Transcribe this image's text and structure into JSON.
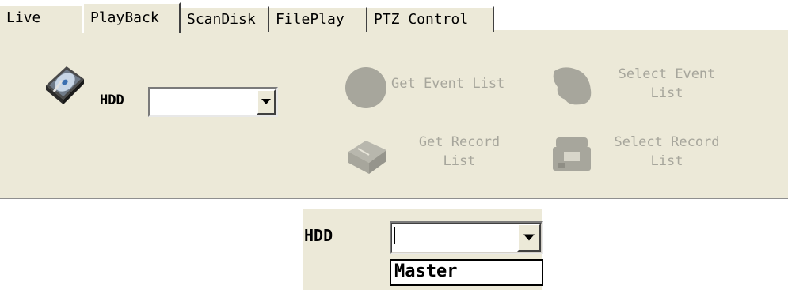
{
  "tabs": [
    {
      "label": "Live"
    },
    {
      "label": "PlayBack"
    },
    {
      "label": "ScanDisk"
    },
    {
      "label": "FilePlay"
    },
    {
      "label": "PTZ Control"
    }
  ],
  "selected_tab": "PlayBack",
  "playback": {
    "hdd_label": "HDD",
    "hdd_icon": "hard-disk-icon",
    "hdd_value": "",
    "actions": {
      "get_event_list": "Get Event List",
      "select_event_list_1": "Select Event",
      "select_event_list_2": "List",
      "get_record_list_1": "Get Record",
      "get_record_list_2": "List",
      "select_record_list_1": "Select Record",
      "select_record_list_2": "List"
    },
    "disabled_color": "#a7a69c",
    "panel_color": "#ece9d8"
  },
  "detail": {
    "hdd_label": "HDD",
    "dropdown_value": "",
    "options": [
      "Master"
    ]
  }
}
